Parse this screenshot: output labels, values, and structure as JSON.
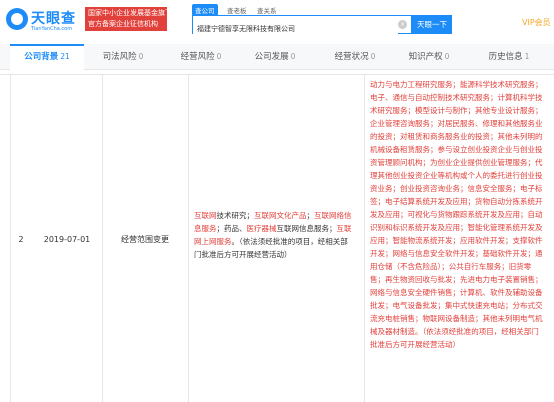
{
  "header": {
    "logo_text": "天眼查",
    "logo_sub": "TianYanCha.com",
    "badge_line1": "国家中小企业发展基金旗下",
    "badge_line2": "官方备案企业征信机构",
    "search_tabs": [
      "查公司",
      "查老板",
      "查关系"
    ],
    "search_value": "福建宁德智享无限科技有限公司",
    "search_button": "天眼一下",
    "vip": "VIP会员",
    "brand_color": "#1d8cf8",
    "badge_color": "#e2403b"
  },
  "tabs": [
    {
      "label": "公司背景",
      "count": "21",
      "active": true
    },
    {
      "label": "司法风险",
      "count": "0"
    },
    {
      "label": "经营风险",
      "count": "0"
    },
    {
      "label": "公司发展",
      "count": "0"
    },
    {
      "label": "经营状况",
      "count": "0"
    },
    {
      "label": "知识产权",
      "count": "0"
    },
    {
      "label": "历史信息",
      "count": "1"
    }
  ],
  "record": {
    "index": "2",
    "date": "2019-07-01",
    "type": "经营范围变更",
    "before_segments": [
      {
        "t": "互联网",
        "h": true
      },
      {
        "t": "技术研究；",
        "h": false
      },
      {
        "t": "互联网文化产品",
        "h": true
      },
      {
        "t": "；",
        "h": false
      },
      {
        "t": "互联网络信息服务",
        "h": true
      },
      {
        "t": "；药品、",
        "h": false
      },
      {
        "t": "医疗器械",
        "h": true
      },
      {
        "t": "互联网信息服务；",
        "h": false
      },
      {
        "t": "互联网上网服务",
        "h": true
      },
      {
        "t": "。（依法须经批准的项目，经相关部门批准后方可开展经营活动）",
        "h": false
      }
    ],
    "after_segments": [
      {
        "t": "动力与电力工程研究服务；能源科学技术研究服务；电子、通信与自动控制技术研究服务；计算机科学技术研究服务；模型设计与制作；其他专业设计服务；企业管理咨询服务；对居民服务、修理和其他服务业的投资；对租赁和商务服务业的投资；其他未列明的机械设备租赁服务；参与设立创业投资企业与创业投资管理顾问机构；为创业企业提供创业管理服务；代理其他创业投资企业等机构或个人的委托进行创业投资业务；创业投资咨询业务；信息安全服务；电子标签；电子结算系统开发及应用；货物自动分拣系统开发及应用；可视化与货物跟踪系统开发及应用；自动识别和标识系统开发及应用；智能化管理系统开发及应用；智能物流系统开发；应用软件开发；支撑软件开发；网络与信息安全软件开发；基础软件开发；通用仓储（不含危险品）；公共自行车服务；旧货零售；再生物资回收与批发；先进电力电子装置销售；网络与信息安全硬件销售；计算机、软件及辅助设备批发；电气设备批发；集中式快速充电站；分布式交流充电桩销售；物联网设备制造；其他未列明电气机械及器材制造。（依法须经批准的项目，经相关部门批准后方可开展经营活动）",
        "h": true
      }
    ]
  }
}
